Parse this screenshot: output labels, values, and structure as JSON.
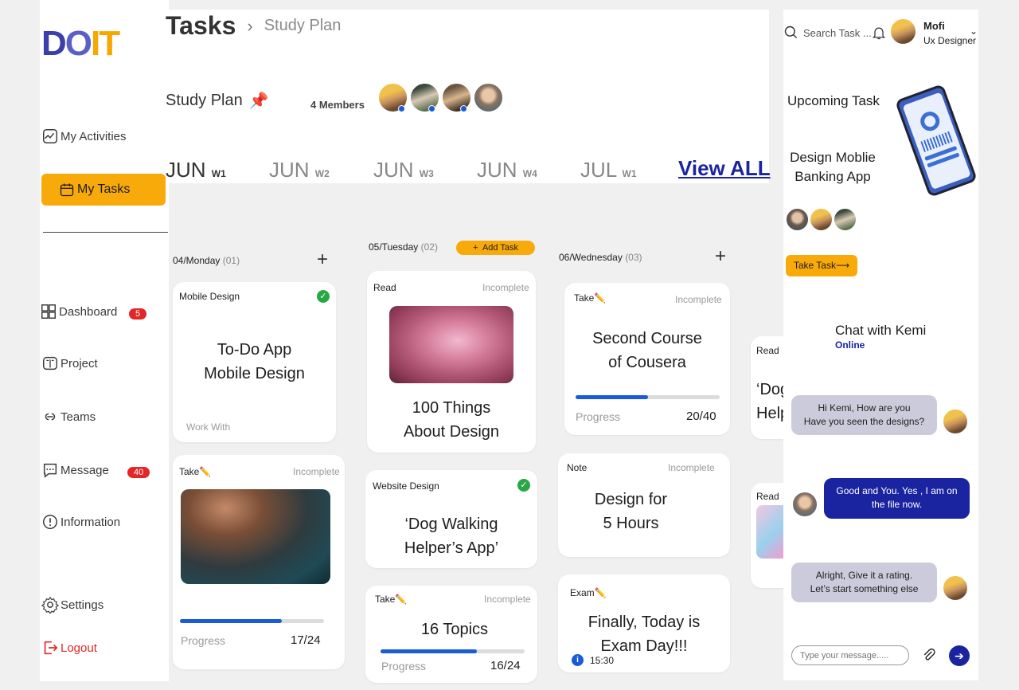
{
  "app": {
    "logo_text": "DOIT"
  },
  "sidebar": {
    "my_activities": "My Activities",
    "my_tasks": "My Tasks",
    "items": [
      {
        "label": "Dashboard",
        "badge": "5"
      },
      {
        "label": "Project"
      },
      {
        "label": "Teams"
      },
      {
        "label": "Message",
        "badge": "40"
      },
      {
        "label": "Information"
      }
    ],
    "settings": "Settings",
    "logout": "Logout"
  },
  "header": {
    "title": "Tasks",
    "crumb": "Study Plan",
    "plan_title": "Study Plan",
    "plan_emoji": "📌",
    "members": "4 Members"
  },
  "weeks": [
    {
      "month": "JUN",
      "week": "W1"
    },
    {
      "month": "JUN",
      "week": "W2"
    },
    {
      "month": "JUN",
      "week": "W3"
    },
    {
      "month": "JUN",
      "week": "W4"
    },
    {
      "month": "JUL",
      "week": "W1"
    }
  ],
  "view_all": "View ALL",
  "columns": [
    {
      "day": "04/Monday",
      "count": "(01)"
    },
    {
      "day": "05/Tuesday",
      "count": "(02)",
      "add_task": "Add Task"
    },
    {
      "day": "06/Wednesday",
      "count": "(03)"
    }
  ],
  "cards": {
    "c1": {
      "tag": "Mobile Design",
      "title1": "To-Do App",
      "title2": "Mobile Design",
      "footer": "Work With"
    },
    "c2": {
      "tag": "Take✏️",
      "status": "Incomplete",
      "progress_label": "Progress",
      "progress_value": "17/24",
      "progress": 0.708
    },
    "c3": {
      "tag": "Read",
      "status": "Incomplete",
      "title1": "100 Things",
      "title2": "About Design"
    },
    "c4": {
      "tag": "Website Design",
      "title1": "‘Dog Walking",
      "title2": "Helper’s App’"
    },
    "c5": {
      "tag": "Take✏️",
      "status": "Incomplete",
      "title": "16 Topics",
      "progress_label": "Progress",
      "progress_value": "16/24",
      "progress": 0.667
    },
    "c6": {
      "tag": "Take✏️",
      "status": "Incomplete",
      "title1": "Second Course",
      "title2": "of Cousera",
      "progress_label": "Progress",
      "progress_value": "20/40",
      "progress": 0.5
    },
    "c7": {
      "tag": "Note",
      "status": "Incomplete",
      "title1": "Design for",
      "title2": "5 Hours"
    },
    "c8": {
      "tag": "Exam✏️",
      "title1": "Finally, Today is",
      "title2": "Exam Day!!!",
      "time": "15:30"
    },
    "c9": {
      "tag": "Read",
      "title1": "‘Dog",
      "title2": "Help"
    },
    "c10": {
      "tag": "Read"
    }
  },
  "right": {
    "search_placeholder": "Search Task ...",
    "user_name": "Mofi",
    "user_role": "Ux Designer",
    "upcoming": "Upcoming Task",
    "upcoming_task1": "Design  Moblie",
    "upcoming_task2": "Banking App",
    "take_task": "Take Task⟶",
    "chat_title": "Chat with Kemi",
    "chat_status": "Online",
    "messages": [
      {
        "line1": "Hi Kemi, How are you",
        "line2": "Have you seen the designs?"
      },
      {
        "line1": "Good and You. Yes , I am on",
        "line2": "the file now."
      },
      {
        "line1": "Alright, Give it a rating.",
        "line2": "Let’s start something else"
      }
    ],
    "message_placeholder": "Type your message....."
  },
  "colors": {
    "accent": "#f9aa0b",
    "primary": "#1a24a0",
    "progress": "#1a5cd6",
    "danger": "#e32626",
    "success": "#27a745"
  }
}
